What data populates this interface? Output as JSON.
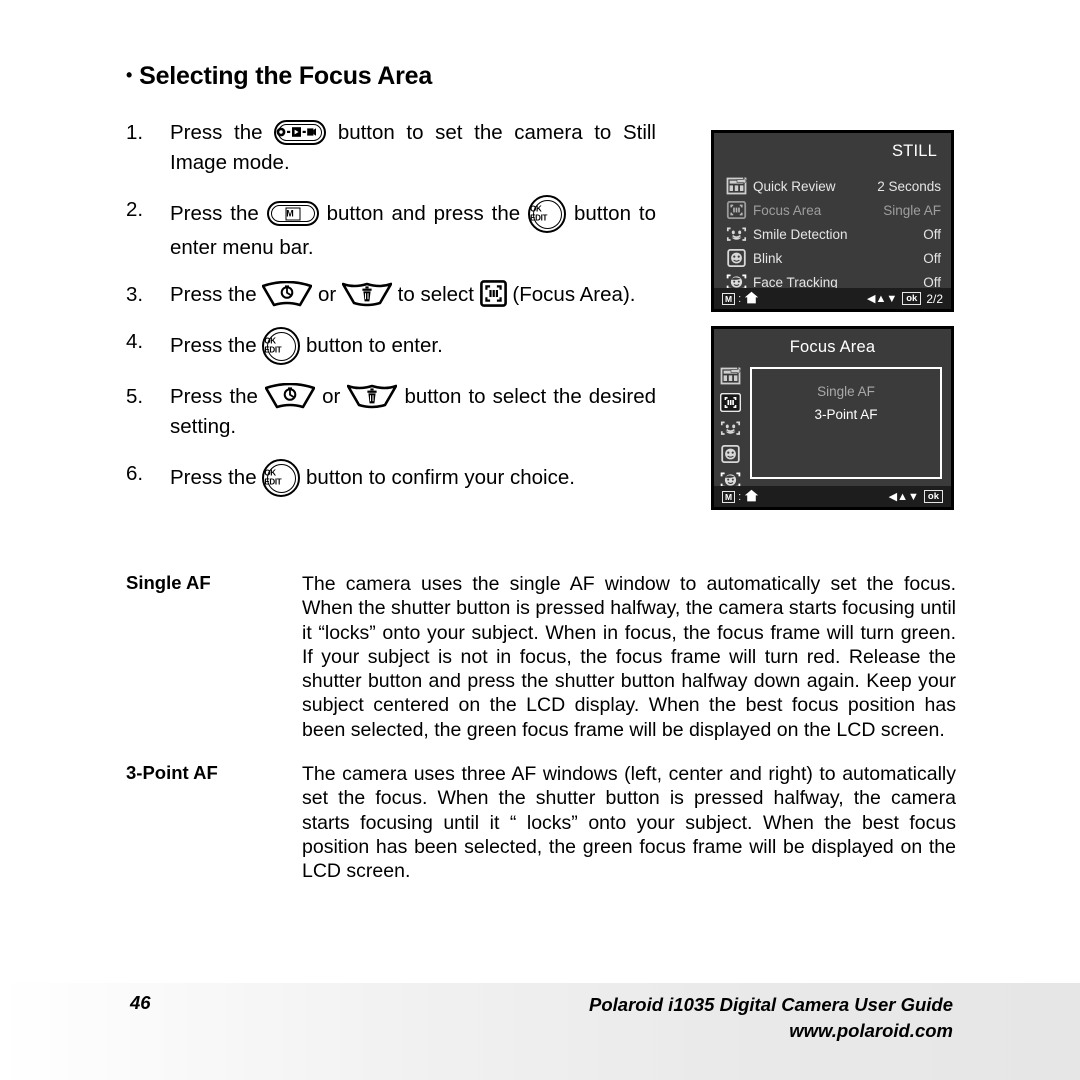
{
  "heading": {
    "bullet": "•",
    "title": "Selecting the Focus Area"
  },
  "steps": [
    {
      "num": "1.",
      "pre": "Press the",
      "icon": "mode-button",
      "post": "button to set the camera to Still Image mode."
    },
    {
      "num": "2.",
      "pre": "Press the",
      "icon": "menu-m-button",
      "mid": "button and press the",
      "icon2": "ok-edit-button",
      "post": "button to enter menu bar."
    },
    {
      "num": "3.",
      "pre": "Press the",
      "icon": "up-key",
      "mid": "or",
      "icon2": "down-key",
      "mid2": "to select",
      "icon3": "focus-area-icon",
      "post": "(Focus Area)."
    },
    {
      "num": "4.",
      "pre": "Press the",
      "icon": "ok-edit-button",
      "post": "button to enter."
    },
    {
      "num": "5.",
      "pre": "Press the",
      "icon": "up-key",
      "mid": "or",
      "icon2": "down-key",
      "post": "button to select the desired setting."
    },
    {
      "num": "6.",
      "pre": "Press the",
      "icon": "ok-edit-button",
      "post": "button to confirm your choice."
    }
  ],
  "step_text": {
    "s1_pre": "Press the",
    "s1_post": "button to set the camera to Still Image mode.",
    "s2_pre": "Press the",
    "s2_mid": "button and press the",
    "s2_post": "button to enter menu bar.",
    "s3_pre": "Press the",
    "s3_mid": "or",
    "s3_mid2": "to select",
    "s3_post": "(Focus Area).",
    "s4_pre": "Press the",
    "s4_post": "button to enter.",
    "s5_pre": "Press the",
    "s5_mid": "or",
    "s5_post": "button to select the desired setting.",
    "s6_pre": "Press the",
    "s6_post": "button to confirm your choice."
  },
  "buttons": {
    "ok_line1": "OK",
    "ok_line2": "EDIT",
    "m_label": "M"
  },
  "lcd_menu": {
    "title": "STILL",
    "rows": [
      {
        "icon": "quick-review-icon",
        "label": "Quick Review",
        "value": "2 Seconds",
        "dim": false
      },
      {
        "icon": "focus-area-icon",
        "label": "Focus Area",
        "value": "Single AF",
        "dim": true
      },
      {
        "icon": "smile-detection-icon",
        "label": "Smile Detection",
        "value": "Off",
        "dim": false
      },
      {
        "icon": "blink-icon",
        "label": "Blink",
        "value": "Off",
        "dim": false
      },
      {
        "icon": "face-tracking-icon",
        "label": "Face Tracking",
        "value": "Off",
        "dim": false
      }
    ],
    "bottom": {
      "m_key": "M",
      "colon": ":",
      "home_icon": "home-icon",
      "arrows": "◀▲▼",
      "ok_key": "ok",
      "page": "2/2"
    }
  },
  "lcd_focus": {
    "title": "Focus Area",
    "options": [
      {
        "label": "Single AF",
        "selected": false
      },
      {
        "label": "3-Point AF",
        "selected": true
      }
    ],
    "side_icons": [
      "quick-review-icon",
      "focus-area-icon",
      "smile-detection-icon",
      "blink-icon",
      "face-tracking-icon"
    ],
    "bottom": {
      "m_key": "M",
      "colon": ":",
      "home_icon": "home-icon",
      "arrows": "◀▲▼",
      "ok_key": "ok"
    }
  },
  "definitions": [
    {
      "term": "Single AF",
      "body": "The camera uses the single AF window to automatically set the focus. When the shutter button is pressed halfway, the camera starts focusing until it “locks” onto your subject. When in focus, the focus frame will turn green. If your subject is not in focus, the focus frame will turn red. Release the shutter button and press the shutter button halfway down again. Keep your subject centered on the LCD display. When the best focus position has been selected, the green focus frame will be displayed on the LCD screen."
    },
    {
      "term": "3-Point AF",
      "body": "The camera uses three AF windows (left, center and right) to automatically set the focus. When the shutter button is pressed halfway, the camera starts focusing until it “ locks” onto your subject. When the best focus position has been selected, the green focus frame will be displayed on the LCD screen."
    }
  ],
  "footer": {
    "page_number": "46",
    "guide_title": "Polaroid i1035 Digital Camera User Guide",
    "website": "www.polaroid.com"
  },
  "colors": {
    "lcd_background": "#3b3b3b",
    "lcd_bottom_bar": "#1d1d1d",
    "lcd_text": "#e9e9e9",
    "lcd_dim_text": "#9e9e9e",
    "page_background": "#ffffff",
    "text": "#000000"
  }
}
